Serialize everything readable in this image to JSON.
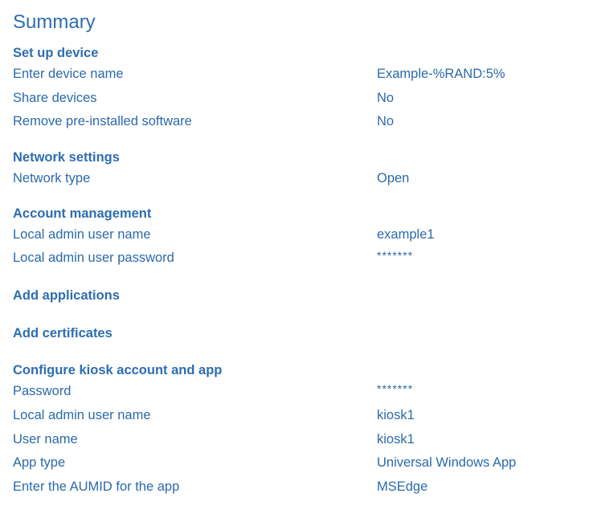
{
  "page": {
    "title": "Summary"
  },
  "sections": {
    "setup_device": {
      "heading": "Set up device",
      "rows": [
        {
          "label": "Enter device name",
          "value": "Example-%RAND:5%"
        },
        {
          "label": "Share devices",
          "value": "No"
        },
        {
          "label": "Remove pre-installed software",
          "value": "No"
        }
      ]
    },
    "network": {
      "heading": "Network settings",
      "rows": [
        {
          "label": "Network type",
          "value": "Open"
        }
      ]
    },
    "account": {
      "heading": "Account management",
      "rows": [
        {
          "label": "Local admin user name",
          "value": "example1"
        },
        {
          "label": "Local admin user password",
          "value": "*******"
        }
      ]
    },
    "applications": {
      "heading": "Add applications"
    },
    "certificates": {
      "heading": "Add certificates"
    },
    "kiosk": {
      "heading": "Configure kiosk account and app",
      "rows": [
        {
          "label": "Password",
          "value": "*******"
        },
        {
          "label": "Local admin user name",
          "value": "kiosk1"
        },
        {
          "label": "User name",
          "value": "kiosk1"
        },
        {
          "label": "App type",
          "value": "Universal Windows App"
        },
        {
          "label": "Enter the AUMID for the app",
          "value": "MSEdge"
        }
      ]
    }
  },
  "colors": {
    "text": "#2b6aa8",
    "background": "#ffffff"
  }
}
